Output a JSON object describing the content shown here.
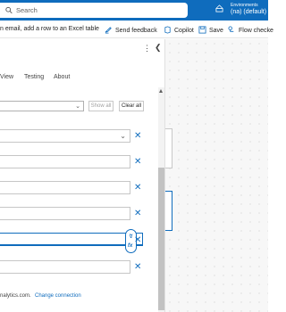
{
  "header": {
    "search_placeholder": "Search",
    "environment_label": "Environments",
    "environment_value": "(na) (default)",
    "brand_color": "#0f6cbd"
  },
  "commandbar": {
    "flow_title": "n email, add a row to an Excel table",
    "send_feedback": "Send feedback",
    "copilot": "Copilot",
    "save": "Save",
    "flow_checker": "Flow checke"
  },
  "panel": {
    "tabs": [
      "View",
      "Testing",
      "About"
    ],
    "show_all": "Show all",
    "clear_all": "Clear all",
    "footer_text": "nalytics.com.",
    "change_connection": "Change connection"
  },
  "icons": {
    "search": "search-icon",
    "environment": "globe-icon",
    "feedback": "feedback-icon",
    "copilot": "copilot-icon",
    "save": "save-icon",
    "flow_checker": "flow-checker-icon",
    "clear": "close-icon",
    "more": "more-vertical-icon",
    "collapse": "chevron-left-icon",
    "dynamic_content": "lightning-icon",
    "expression": "fx-icon"
  }
}
